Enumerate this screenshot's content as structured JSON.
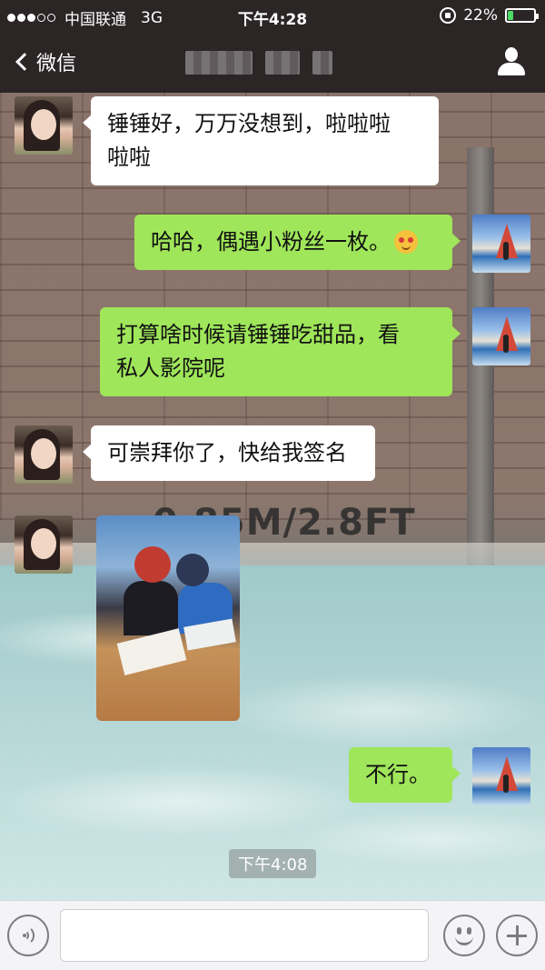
{
  "status_bar": {
    "carrier": "中国联通",
    "network": "3G",
    "time": "下午4:28",
    "battery": "22%",
    "battery_level": 0.22
  },
  "nav": {
    "back_label": "微信"
  },
  "messages": [
    {
      "side": "left",
      "sender": "contact",
      "text_line1": "锤锤好，万万没想到，啦啦啦",
      "text_line2": "啦啦"
    },
    {
      "side": "right",
      "sender": "me",
      "text": "哈哈，偶遇小粉丝一枚。",
      "emoji": "grinning-heart-eyes-emoji"
    },
    {
      "side": "right",
      "sender": "me",
      "text_line1": "打算啥时候请锤锤吃甜品，看",
      "text_line2": "私人影院呢"
    },
    {
      "side": "left",
      "sender": "contact",
      "text": "可崇拜你了，快给我签名"
    },
    {
      "side": "left",
      "sender": "contact",
      "type": "photo"
    },
    {
      "side": "right",
      "sender": "me",
      "text": "不行。"
    }
  ],
  "background_sign": "0.85M/2.8FT",
  "timestamp": "下午4:08",
  "input": {
    "placeholder": ""
  },
  "icons": {
    "back": "chevron-left-icon",
    "contact_info": "user-icon",
    "voice": "voice-icon",
    "emoji": "emoji-icon",
    "more": "plus-icon"
  },
  "colors": {
    "header_bg": "#2b2526",
    "bubble_mine": "#9fe65a",
    "bubble_theirs": "#ffffff",
    "battery_fill": "#4cd964"
  }
}
